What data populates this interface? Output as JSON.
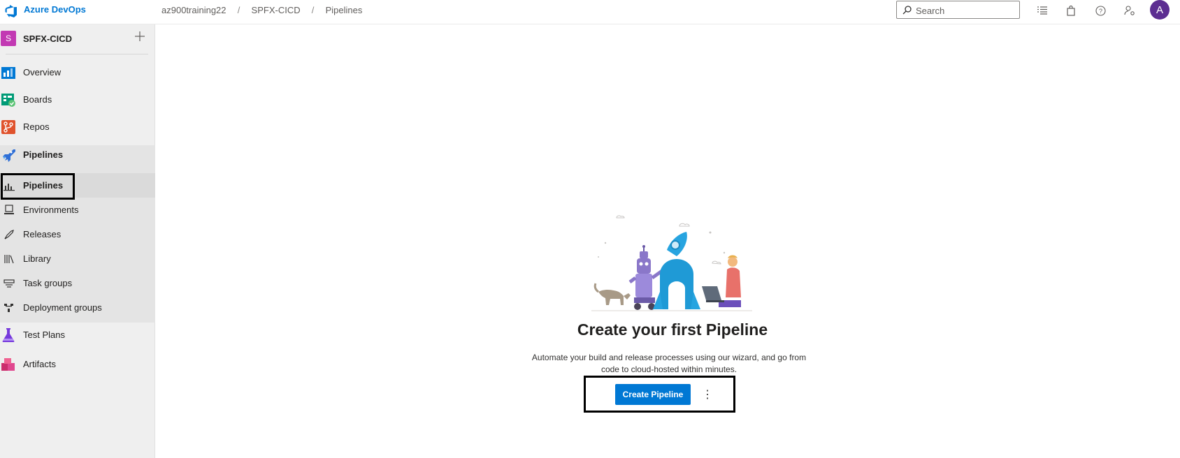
{
  "header": {
    "brand": "Azure DevOps",
    "breadcrumb": [
      "az900training22",
      "SPFX-CICD",
      "Pipelines"
    ],
    "search_placeholder": "Search",
    "avatar_letter": "A",
    "icons": [
      "list-icon",
      "shopping-bag-icon",
      "help-icon",
      "user-settings-icon"
    ]
  },
  "sidebar": {
    "project": {
      "badge": "S",
      "name": "SPFX-CICD",
      "badge_color": "#c239b3"
    },
    "items": [
      {
        "label": "Overview",
        "icon": "overview-icon"
      },
      {
        "label": "Boards",
        "icon": "boards-icon"
      },
      {
        "label": "Repos",
        "icon": "repos-icon"
      },
      {
        "label": "Pipelines",
        "icon": "pipelines-icon"
      }
    ],
    "pipelines_sub": [
      {
        "label": "Pipelines",
        "icon": "pipelines-sub-icon",
        "selected": true
      },
      {
        "label": "Environments",
        "icon": "environments-icon"
      },
      {
        "label": "Releases",
        "icon": "releases-icon"
      },
      {
        "label": "Library",
        "icon": "library-icon"
      },
      {
        "label": "Task groups",
        "icon": "task-groups-icon"
      },
      {
        "label": "Deployment groups",
        "icon": "deployment-groups-icon"
      }
    ],
    "bottom_items": [
      {
        "label": "Test Plans",
        "icon": "test-plans-icon"
      },
      {
        "label": "Artifacts",
        "icon": "artifacts-icon"
      }
    ]
  },
  "main": {
    "title": "Create your first Pipeline",
    "description_line1": "Automate your build and release processes using our wizard, and go from",
    "description_line2": "code to cloud-hosted within minutes.",
    "button": "Create Pipeline",
    "more": "⋮"
  },
  "colors": {
    "accent": "#0078d4",
    "avatar": "#5c2e91"
  }
}
